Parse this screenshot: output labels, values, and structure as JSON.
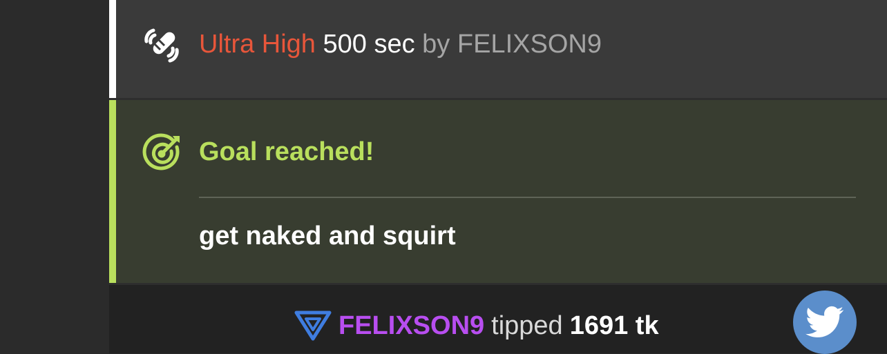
{
  "vibe_message": {
    "level": "Ultra High",
    "duration": "500 sec",
    "by_label": "by",
    "user": "FELIXSON9",
    "icon": "vibration-icon"
  },
  "goal_message": {
    "title": "Goal reached!",
    "text": "get naked and squirt",
    "icon": "target-icon"
  },
  "tip_message": {
    "user": "FELIXSON9",
    "action": "tipped",
    "amount": "1691 tk",
    "badge_icon": "triangle-badge-icon"
  },
  "share": {
    "icon": "twitter-icon"
  },
  "colors": {
    "level": "#e8563a",
    "goal_accent": "#b9df5d",
    "tipper": "#b84ef0",
    "twitter": "#5b8ecb"
  }
}
